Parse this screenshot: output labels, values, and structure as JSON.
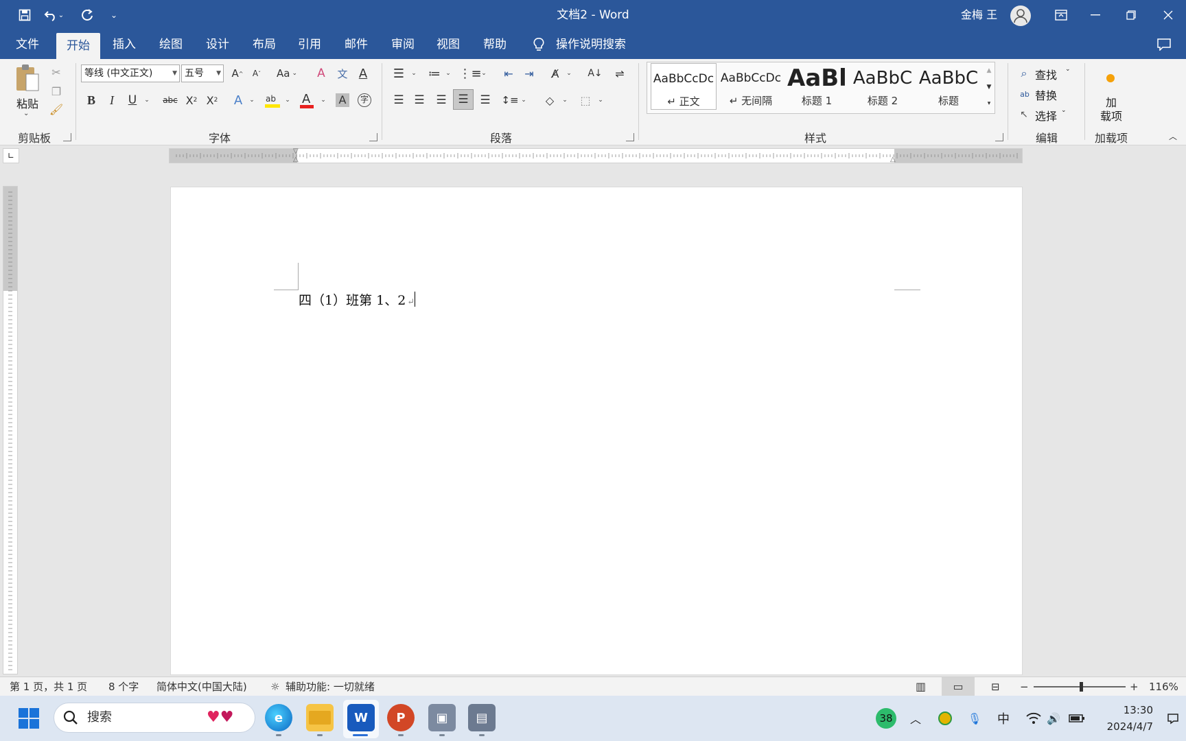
{
  "window": {
    "title": "文档2  -  Word",
    "user": "金梅 王"
  },
  "tabs": [
    "文件",
    "开始",
    "插入",
    "绘图",
    "设计",
    "布局",
    "引用",
    "邮件",
    "审阅",
    "视图",
    "帮助"
  ],
  "tell_me": "操作说明搜索",
  "ribbon": {
    "clipboard": {
      "paste_label": "粘贴",
      "group_label": "剪贴板"
    },
    "font": {
      "font_name": "等线 (中文正文)",
      "font_size": "五号",
      "group_label": "字体",
      "change_case": "Aa"
    },
    "paragraph": {
      "group_label": "段落"
    },
    "styles": {
      "group_label": "样式",
      "items": [
        {
          "preview": "AaBbCcDc",
          "name": "正文"
        },
        {
          "preview": "AaBbCcDc",
          "name": "无间隔"
        },
        {
          "preview": "AaBl",
          "name": "标题 1"
        },
        {
          "preview": "AaBbC",
          "name": "标题 2"
        },
        {
          "preview": "AaBbC",
          "name": "标题"
        }
      ]
    },
    "editing": {
      "find": "查找",
      "replace": "替换",
      "select": "选择",
      "group_label": "编辑"
    },
    "addins": {
      "button_label": "加\n载项",
      "group_label": "加载项"
    }
  },
  "document": {
    "text": "四（1）班第 1、2"
  },
  "status": {
    "page": "第 1 页，共 1 页",
    "words": "8 个字",
    "language": "简体中文(中国大陆)",
    "accessibility": "辅助功能: 一切就绪",
    "zoom": "116%",
    "zoom_level": 1.16
  },
  "taskbar": {
    "search_placeholder": "搜索",
    "weather_badge": "38",
    "ime": "中",
    "time": "13:30",
    "date": "2024/4/7"
  },
  "colors": {
    "word_blue": "#2b579a",
    "taskbar_bg": "#dde6f2"
  }
}
